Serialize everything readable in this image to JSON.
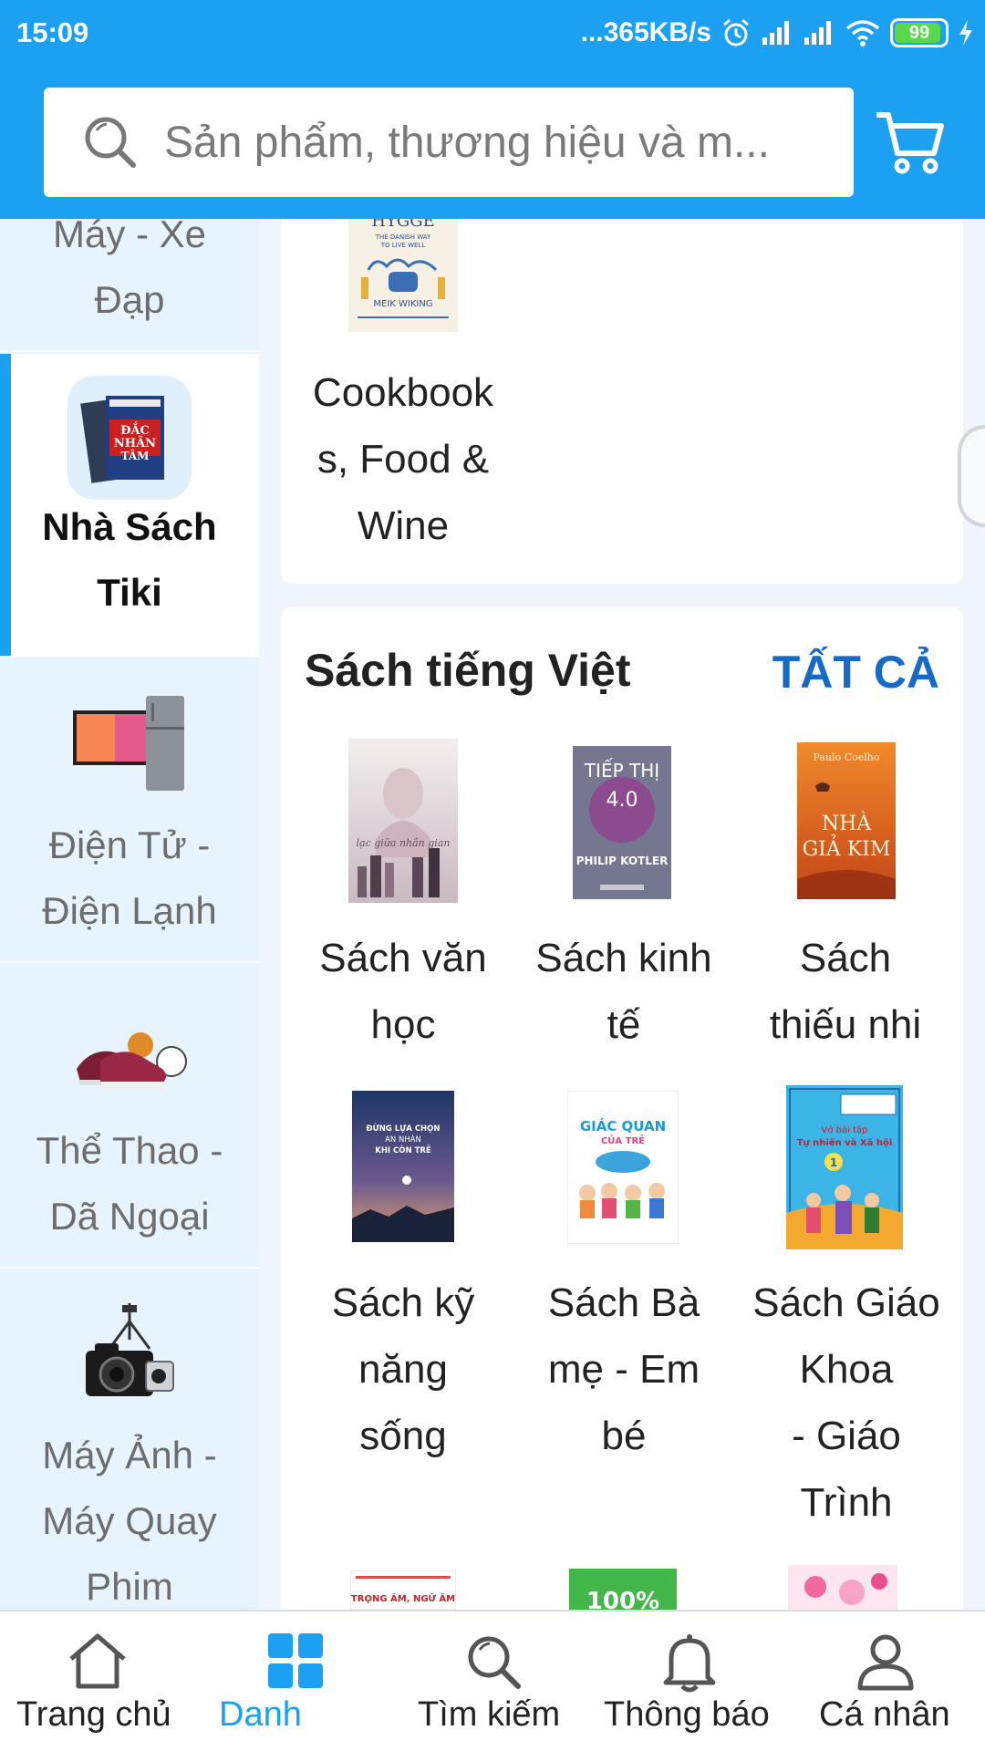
{
  "status_bar": {
    "time": "15:09",
    "network_speed": "...365KB/s",
    "battery_level": "99",
    "icons": [
      "alarm-icon",
      "signal-icon",
      "signal-icon",
      "wifi-icon",
      "battery-icon",
      "charging-icon"
    ]
  },
  "header": {
    "search_placeholder": "Sản phẩm, thương hiệu và m...",
    "accent_color": "#1ba0f2"
  },
  "sidebar": {
    "categories": [
      {
        "label_lines": [
          "Máy - Xe",
          "Đạp"
        ],
        "active": false,
        "icon": "bicycle-icon"
      },
      {
        "label_lines": [
          "Nhà Sách",
          "Tiki"
        ],
        "active": true,
        "icon": "book-icon"
      },
      {
        "label_lines": [
          "Điện Tử -",
          "Điện Lạnh"
        ],
        "active": false,
        "icon": "tv-fridge-icon"
      },
      {
        "label_lines": [
          "Thể Thao -",
          "Dã Ngoại"
        ],
        "active": false,
        "icon": "sports-shoes-icon"
      },
      {
        "label_lines": [
          "Máy Ảnh -",
          "Máy Quay",
          "Phim"
        ],
        "active": false,
        "icon": "camera-icon"
      }
    ]
  },
  "content": {
    "prev_card": {
      "book_cover_text": [
        "HYGGE",
        "THE DANISH WAY",
        "TO LIVE WELL",
        "MEIK WIKING"
      ],
      "item_label_lines": [
        "Cookbook",
        "s, Food &",
        "Wine"
      ]
    },
    "section": {
      "title": "Sách tiếng Việt",
      "see_all": "TẤT CẢ",
      "see_all_color": "#1769c7",
      "items": [
        {
          "label_lines": [
            "Sách văn",
            "học"
          ],
          "cover_text": "lạc giữa nhân gian"
        },
        {
          "label_lines": [
            "Sách kinh",
            "tế"
          ],
          "cover_text": [
            "TIẾP THỊ",
            "4.0",
            "PHILIP KOTLER"
          ]
        },
        {
          "label_lines": [
            "Sách",
            "thiếu nhi"
          ],
          "cover_text": [
            "Paulo Coelho",
            "NHÀ",
            "GIẢ KIM"
          ]
        },
        {
          "label_lines": [
            "Sách kỹ",
            "năng",
            "sống"
          ],
          "cover_text": [
            "ĐỪNG LỰA CHỌN",
            "AN NHÀN",
            "KHI CÒN TRẺ"
          ]
        },
        {
          "label_lines": [
            "Sách Bà",
            "mẹ - Em",
            "bé"
          ],
          "cover_text": [
            "GIÁC QUAN",
            "CỦA TRẺ"
          ]
        },
        {
          "label_lines": [
            "Sách Giáo",
            "Khoa",
            "- Giáo",
            "Trình"
          ],
          "cover_text": [
            "Vở bài tập",
            "Tự nhiên và Xã hội",
            "1"
          ]
        }
      ],
      "partial_row_cover_text": [
        "TRỌNG ÂM, NGỮ ÂM",
        "100%"
      ]
    }
  },
  "bottom_nav": {
    "items": [
      {
        "label": "Trang chủ",
        "icon": "home-icon",
        "active": false
      },
      {
        "label": "Danh",
        "icon": "grid-icon",
        "active": true
      },
      {
        "label": "Tìm kiếm",
        "icon": "search-icon",
        "active": false
      },
      {
        "label": "Thông báo",
        "icon": "bell-icon",
        "active": false
      },
      {
        "label": "Cá nhân",
        "icon": "person-icon",
        "active": false
      }
    ]
  }
}
